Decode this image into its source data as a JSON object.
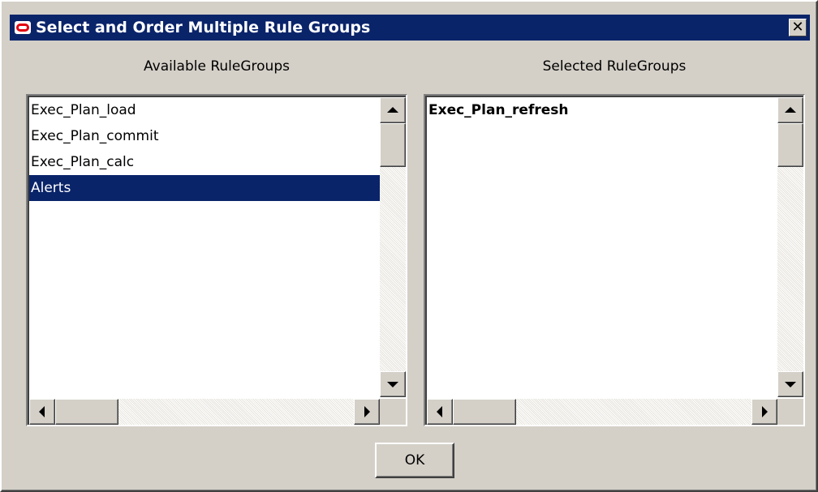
{
  "dialog": {
    "title": "Select and Order Multiple Rule Groups",
    "close_symbol": "✕",
    "ok_label": "OK"
  },
  "available": {
    "label": "Available RuleGroups",
    "items": [
      "Exec_Plan_load",
      "Exec_Plan_commit",
      "Exec_Plan_calc",
      "Alerts"
    ],
    "selected_item": "Alerts"
  },
  "selected": {
    "label": "Selected RuleGroups",
    "items": [
      "Exec_Plan_refresh"
    ]
  },
  "colors": {
    "titlebar": "#0a246a",
    "dialog_face": "#d4d0c8",
    "selection": "#0a246a",
    "logo_red": "#e3000f"
  },
  "icons": [
    "oracle-logo-icon",
    "close-icon",
    "scroll-up-arrow-icon",
    "scroll-down-arrow-icon",
    "scroll-left-arrow-icon",
    "scroll-right-arrow-icon"
  ]
}
